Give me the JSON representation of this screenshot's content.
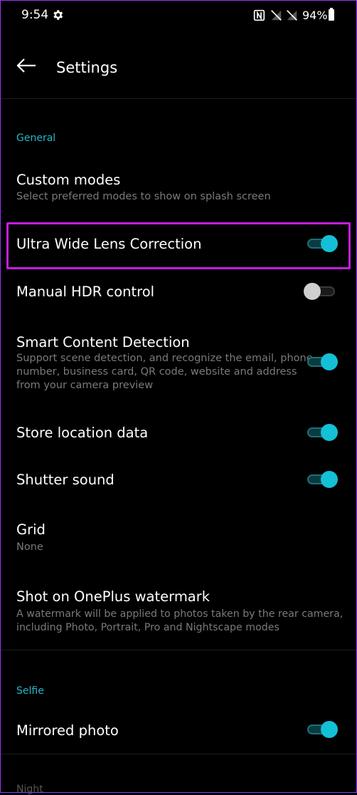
{
  "status_bar": {
    "time": "9:54",
    "battery": "94%",
    "icons": [
      "settings-gear-icon",
      "nfc-icon",
      "no-signal-icon",
      "no-signal-icon",
      "battery-icon"
    ]
  },
  "app_bar": {
    "title": "Settings",
    "back_icon": "arrow-left-icon"
  },
  "colors": {
    "accent": "#14c0d6",
    "highlight": "#c51ce0",
    "background": "#000000",
    "subtitle": "#7a7a7a"
  },
  "sections": {
    "general": "General",
    "selfie": "Selfie",
    "night_partial": "Night"
  },
  "items": {
    "custom_modes": {
      "title": "Custom modes",
      "subtitle": "Select preferred modes to show on splash screen"
    },
    "ultra_wide": {
      "title": "Ultra Wide Lens Correction",
      "enabled": true
    },
    "manual_hdr": {
      "title": "Manual HDR control",
      "enabled": false
    },
    "smart_content": {
      "title": "Smart Content Detection",
      "subtitle": "Support scene detection, and recognize the email, phone\nnumber, business card, QR code, website and address\nfrom your camera preview",
      "enabled": true
    },
    "store_location": {
      "title": "Store location data",
      "enabled": true
    },
    "shutter_sound": {
      "title": "Shutter sound",
      "enabled": true
    },
    "grid": {
      "title": "Grid",
      "value": "None"
    },
    "watermark": {
      "title": "Shot on OnePlus watermark",
      "subtitle": "A watermark will be applied to photos taken by the rear camera,\nincluding Photo, Portrait, Pro and Nightscape modes"
    },
    "mirrored_photo": {
      "title": "Mirrored photo",
      "enabled": true
    }
  }
}
